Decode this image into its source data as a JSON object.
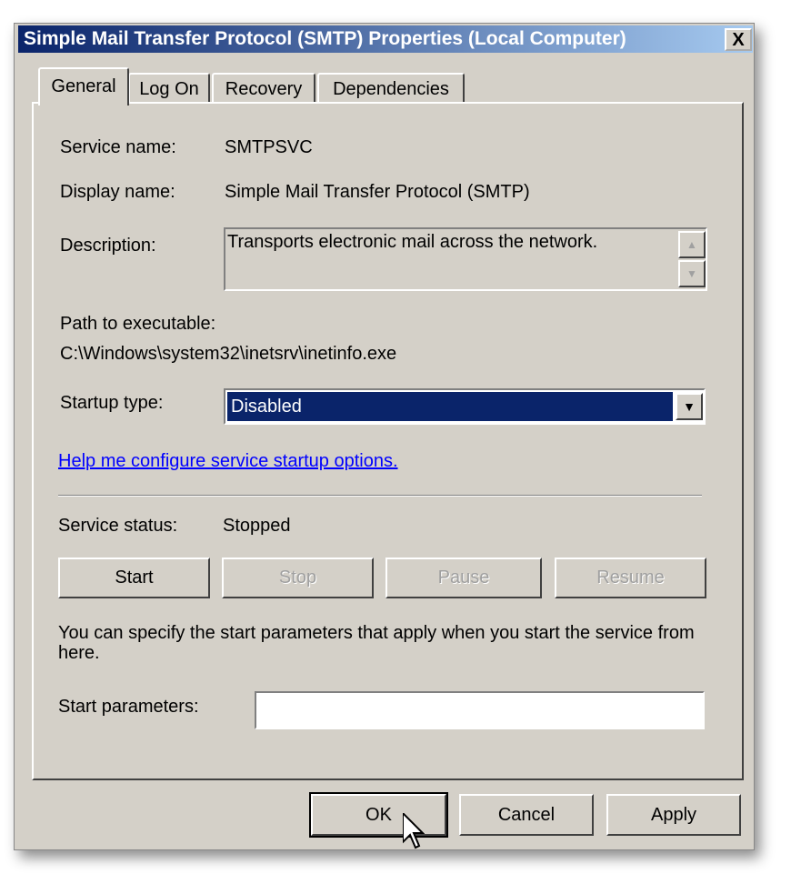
{
  "window": {
    "title": "Simple Mail Transfer Protocol (SMTP) Properties (Local Computer)",
    "close_label": "X"
  },
  "tabs": [
    {
      "label": "General",
      "active": true
    },
    {
      "label": "Log On"
    },
    {
      "label": "Recovery"
    },
    {
      "label": "Dependencies"
    }
  ],
  "general": {
    "service_name_label": "Service name:",
    "service_name": "SMTPSVC",
    "display_name_label": "Display name:",
    "display_name": "Simple Mail Transfer Protocol (SMTP)",
    "description_label": "Description:",
    "description": "Transports electronic mail across the network.",
    "path_label": "Path to executable:",
    "path": "C:\\Windows\\system32\\inetsrv\\inetinfo.exe",
    "startup_type_label": "Startup type:",
    "startup_type": "Disabled",
    "help_link": "Help me configure service startup options.",
    "status_label": "Service status:",
    "status": "Stopped",
    "buttons": {
      "start": "Start",
      "stop": "Stop",
      "pause": "Pause",
      "resume": "Resume"
    },
    "params_note": "You can specify the start parameters that apply when you start the service from here.",
    "params_label": "Start parameters:",
    "params_value": ""
  },
  "footer": {
    "ok": "OK",
    "cancel": "Cancel",
    "apply": "Apply"
  },
  "colors": {
    "title_start": "#0a246a",
    "title_end": "#a6caf0",
    "selection": "#0a246a",
    "link": "#0000ff",
    "face": "#d4d0c8"
  }
}
